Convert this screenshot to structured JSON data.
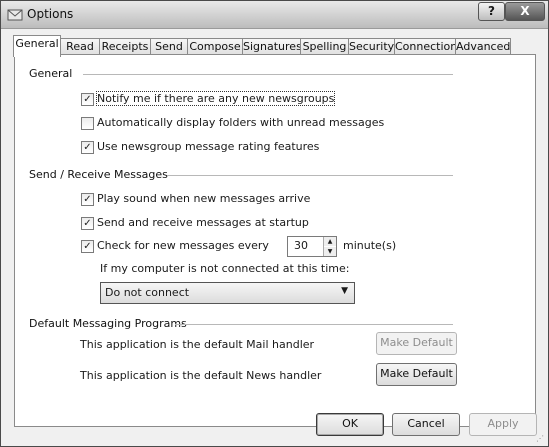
{
  "window": {
    "title": "Options",
    "help_label": "?",
    "close_label": "X",
    "icon": "envelope-icon"
  },
  "tabs": [
    {
      "label": "General",
      "active": true
    },
    {
      "label": "Read"
    },
    {
      "label": "Receipts"
    },
    {
      "label": "Send"
    },
    {
      "label": "Compose"
    },
    {
      "label": "Signatures"
    },
    {
      "label": "Spelling"
    },
    {
      "label": "Security"
    },
    {
      "label": "Connection"
    },
    {
      "label": "Advanced"
    }
  ],
  "general": {
    "heading": "General",
    "notify_new_newsgroups": {
      "label": "Notify me if there are any new newsgroups",
      "checked": true
    },
    "auto_display_unread": {
      "label": "Automatically display folders with unread messages",
      "checked": false
    },
    "use_rating": {
      "label": "Use newsgroup message rating features",
      "checked": true
    }
  },
  "send_receive": {
    "heading": "Send / Receive Messages",
    "play_sound": {
      "label": "Play sound when new messages arrive",
      "checked": true
    },
    "send_receive_startup": {
      "label": "Send and receive messages at startup",
      "checked": true
    },
    "check_every": {
      "label": "Check for new messages every",
      "checked": true
    },
    "minutes_value": "30",
    "minutes_label": "minute(s)",
    "not_connected_label": "If my computer is not connected at this time:",
    "not_connected_value": "Do not connect"
  },
  "default_programs": {
    "heading": "Default Messaging Programs",
    "mail_text": "This application is the default Mail handler",
    "news_text": "This application is the default News handler",
    "make_default_label": "Make Default"
  },
  "footer": {
    "ok": "OK",
    "cancel": "Cancel",
    "apply": "Apply"
  },
  "colors": {
    "window_bg": "#f0f0f0",
    "panel_bg": "#ffffff",
    "border": "#8a8a8a"
  }
}
